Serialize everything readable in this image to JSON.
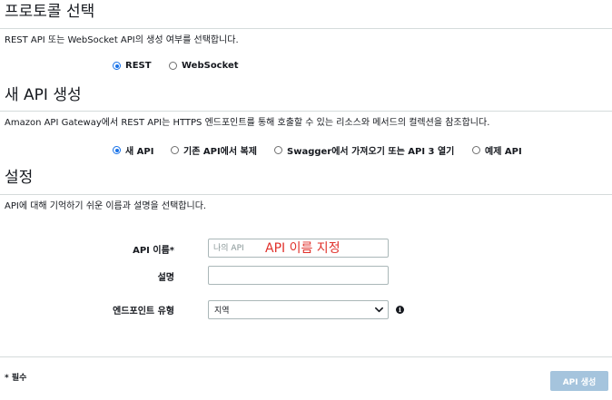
{
  "protocol": {
    "heading": "프로토콜 선택",
    "description": "REST API 또는 WebSocket API의 생성 여부를 선택합니다.",
    "options": [
      {
        "label": "REST",
        "selected": true
      },
      {
        "label": "WebSocket",
        "selected": false
      }
    ]
  },
  "new_api": {
    "heading": "새 API 생성",
    "description": "Amazon API Gateway에서 REST API는 HTTPS 엔드포인트를 통해 호출할 수 있는 리소스와 메서드의 컬렉션을 참조합니다.",
    "options": [
      {
        "label": "새 API",
        "selected": true
      },
      {
        "label": "기존 API에서 복제",
        "selected": false
      },
      {
        "label": "Swagger에서 가져오기 또는 API 3 열기",
        "selected": false
      },
      {
        "label": "예제 API",
        "selected": false
      }
    ]
  },
  "settings": {
    "heading": "설정",
    "description": "API에 대해 기억하기 쉬운 이름과 설명을 선택합니다.",
    "api_name_label": "API 이름*",
    "api_name_placeholder": "나의 API",
    "api_name_annotation": "API 이름 지정",
    "description_label": "설명",
    "description_value": "",
    "endpoint_type_label": "엔드포인트 유형",
    "endpoint_type_value": "지역"
  },
  "footer": {
    "required_note": "* 필수",
    "create_button": "API 생성"
  },
  "colors": {
    "accent": "#1a73e8",
    "annotation": "#e0312b",
    "disabled_button": "#a5c4dd"
  }
}
